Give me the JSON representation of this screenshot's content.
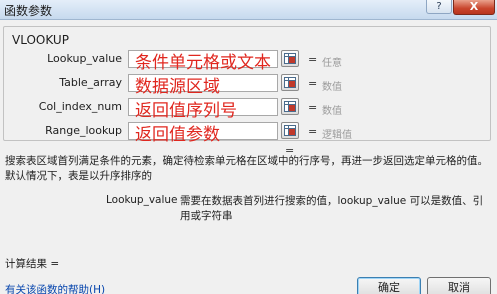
{
  "window": {
    "title": "函数参数",
    "help_button": "?",
    "close_button": "X"
  },
  "function": {
    "name": "VLOOKUP"
  },
  "arguments": [
    {
      "label": "Lookup_value",
      "input": "条件单元格或文本",
      "result": "任意"
    },
    {
      "label": "Table_array",
      "input": "数据源区域",
      "result": "数值"
    },
    {
      "label": "Col_index_num",
      "input": "返回值序列号",
      "result": "数值"
    },
    {
      "label": "Range_lookup",
      "input": "返回值参数",
      "result": "逻辑值"
    }
  ],
  "equals_sign": "=",
  "description": "搜索表区域首列满足条件的元素，确定待检索单元格在区域中的行序号，再进一步返回选定单元格的值。默认情况下，表是以升序排序的",
  "param_help": {
    "name": "Lookup_value",
    "text": "需要在数据表首列进行搜索的值，lookup_value 可以是数值、引用或字符串"
  },
  "calc_result": "计算结果 =",
  "help_link": "有关该函数的帮助(H)",
  "buttons": {
    "ok": "确定",
    "cancel": "取消"
  }
}
